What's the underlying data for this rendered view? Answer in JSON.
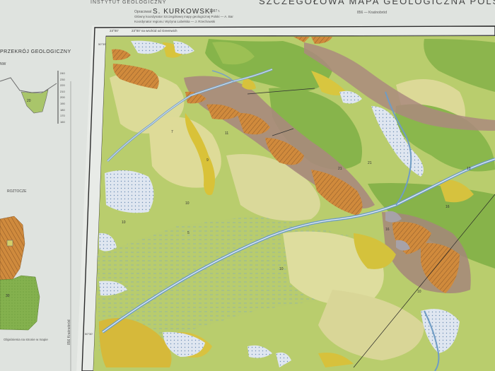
{
  "header": {
    "institute": "INSTYTUT GEOLOGICZNY",
    "author_prefix": "Opracował",
    "author": "S. KURKOWSKI",
    "year": "1987 r.",
    "credit_line1": "Główny koordynator Szczegółowej mapy geologicznej Polski  —  A. Bar",
    "credit_line2": "Koordynator regionu: Wyżyna Lubelska  —  J. Rzechowski",
    "map_title": "SZCZEGÓŁOWA MAPA GEOLOGICZNA POLSKI",
    "sheet_label": "856 — Kraśnobród"
  },
  "side_panel": {
    "profile_title": "PRZEKRÓJ GEOLOGICZNY",
    "profile_subtitle": "NW",
    "profile_scale": [
      "240",
      "230",
      "220",
      "210",
      "200",
      "190",
      "180",
      "170",
      "160"
    ],
    "legend_title": "ROZTOCZE",
    "section_numbers": [
      "20",
      "30"
    ],
    "sheet_side_label": "856  Kraśnobród",
    "footnote": "Objaśnienia na stronie w mapie"
  },
  "map": {
    "corner_coord": "23°00'",
    "corner_label": "23°00' na wschód od Greenwich",
    "frame_ticks": [
      "50°35'",
      "50°30'"
    ],
    "unit_numbers": [
      "7",
      "10",
      "10",
      "10",
      "21",
      "11",
      "9",
      "16",
      "10",
      "5",
      "19",
      "21",
      "16"
    ],
    "colors": {
      "quaternary_green": "#b8cc6a",
      "light_sand": "#dedc9a",
      "loess_yellow": "#d8c13a",
      "sarmatian_olive": "#8fb54a",
      "lias_orange": "#d2873a",
      "marl_brown": "#a88074",
      "peat_blue": "#bcd3e8",
      "river_blue": "#6d9cc4",
      "clay_grey": "#a7a2a8"
    }
  }
}
